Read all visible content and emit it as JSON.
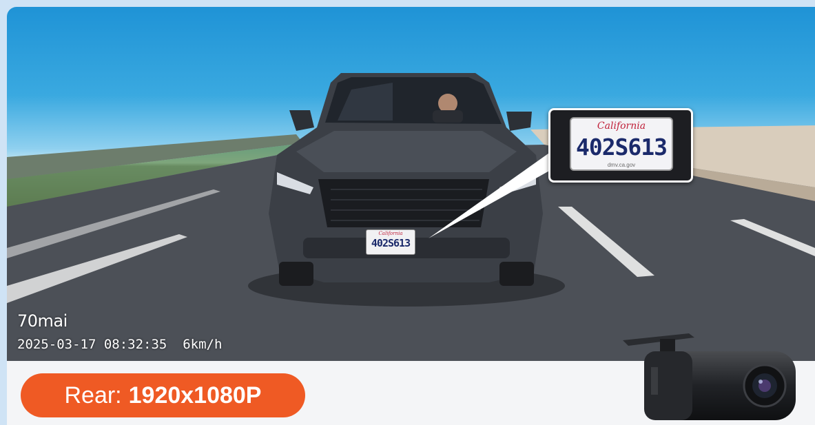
{
  "overlay": {
    "brand": "70mai",
    "timestamp": "2025-03-17 08:32:35",
    "speed": "6km/h"
  },
  "plate": {
    "state": "California",
    "number": "402S613",
    "website": "dmv.ca.gov"
  },
  "badge": {
    "label": "Rear:",
    "value": "1920x1080P",
    "color": "#ef5a24"
  },
  "icons": {
    "product": "rear-camera-icon"
  }
}
